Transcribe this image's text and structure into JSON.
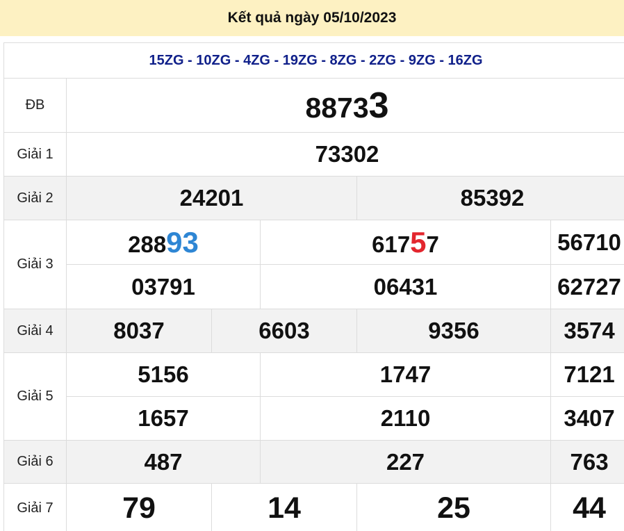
{
  "header": {
    "title": "Kết quả ngày 05/10/2023"
  },
  "codes": "15ZG - 10ZG - 4ZG - 19ZG - 8ZG - 2ZG - 9ZG - 16ZG",
  "prizes": {
    "db": {
      "label": "ĐB",
      "number_prefix": "8873",
      "number_highlight": "3"
    },
    "g1": {
      "label": "Giải 1",
      "numbers": [
        "73302"
      ]
    },
    "g2": {
      "label": "Giải 2",
      "numbers": [
        "24201",
        "85392"
      ]
    },
    "g3": {
      "label": "Giải 3",
      "row1": [
        {
          "prefix": "288",
          "highlight": "93",
          "suffix": ""
        },
        {
          "prefix": "617",
          "highlight": "5",
          "suffix": "7"
        },
        {
          "prefix": "56710",
          "highlight": "",
          "suffix": ""
        }
      ],
      "row2": [
        "03791",
        "06431",
        "62727"
      ]
    },
    "g4": {
      "label": "Giải 4",
      "numbers": [
        "8037",
        "6603",
        "9356",
        "3574"
      ]
    },
    "g5": {
      "label": "Giải 5",
      "row1": [
        "5156",
        "1747",
        "7121"
      ],
      "row2": [
        "1657",
        "2110",
        "3407"
      ]
    },
    "g6": {
      "label": "Giải 6",
      "numbers": [
        "487",
        "227",
        "763"
      ]
    },
    "g7": {
      "label": "Giải 7",
      "numbers": [
        "79",
        "14",
        "25",
        "44"
      ]
    }
  },
  "colors": {
    "header_bg": "#fdf1c2",
    "codes": "#10208a",
    "special_red": "#e3262e",
    "highlight_blue": "#2e86d4",
    "row_shade": "#f2f2f2"
  }
}
